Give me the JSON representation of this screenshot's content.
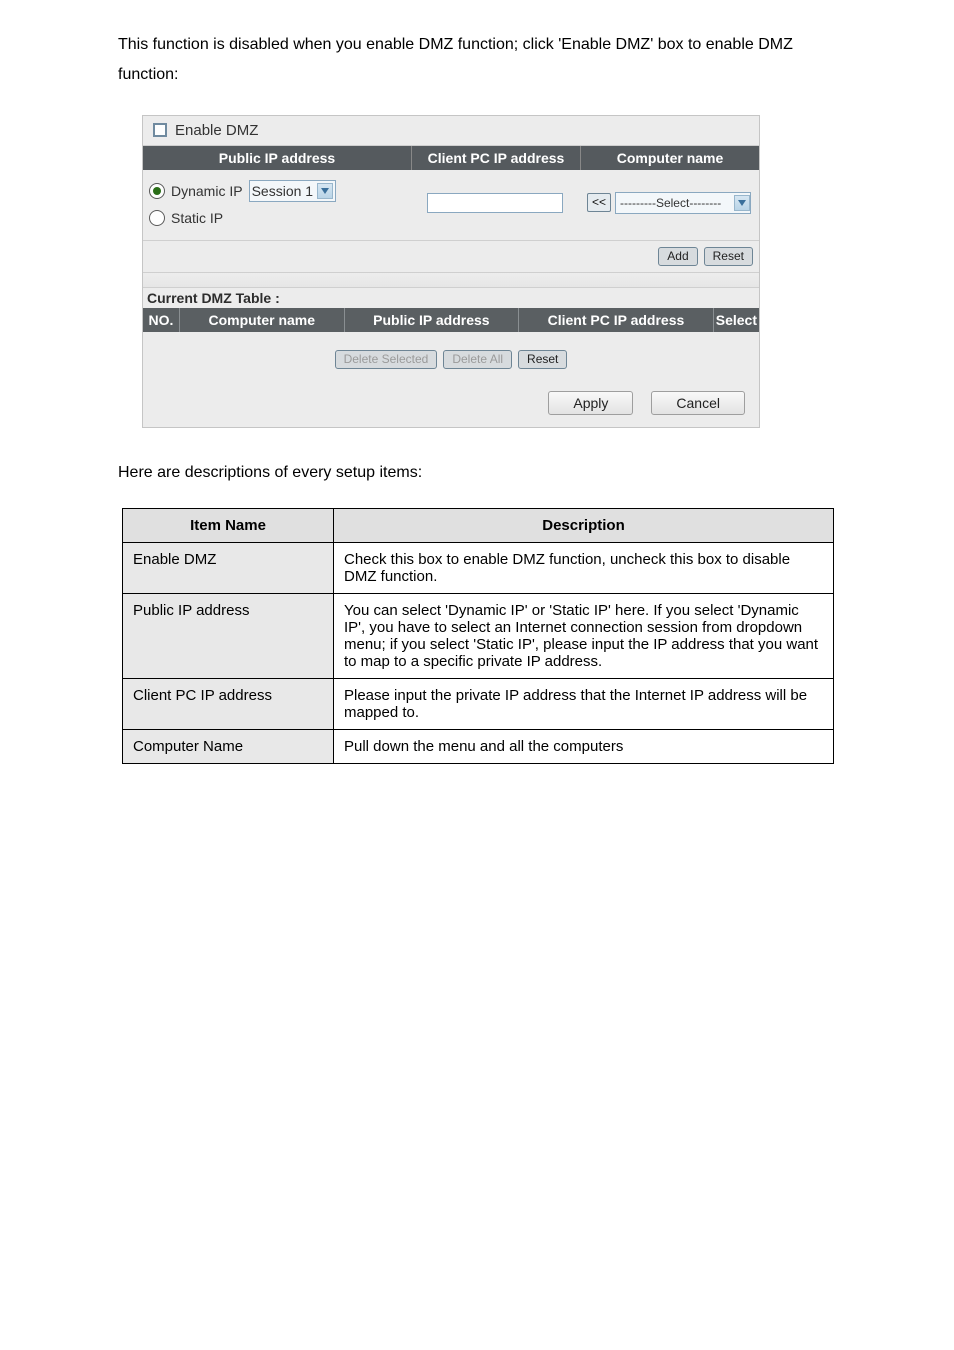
{
  "intro": "This function is disabled when you enable DMZ function; click 'Enable DMZ' box to enable DMZ function:",
  "panel": {
    "enable_label": "Enable DMZ",
    "head": {
      "public_ip": "Public IP address",
      "client_ip": "Client PC IP address",
      "computer": "Computer name"
    },
    "radios": {
      "dynamic": "Dynamic IP",
      "static": "Static IP"
    },
    "session_select": "Session 1",
    "assign_button": "<<",
    "select_placeholder": "---------Select--------",
    "add_button": "Add",
    "reset_button": "Reset",
    "table_title": "Current DMZ Table :",
    "head2": {
      "no": "NO.",
      "computer": "Computer name",
      "public_ip": "Public IP address",
      "client_ip": "Client PC IP address",
      "select": "Select"
    },
    "buttons": {
      "delete_selected": "Delete Selected",
      "delete_all": "Delete All",
      "reset2": "Reset",
      "apply": "Apply",
      "cancel": "Cancel"
    }
  },
  "outtro": "Here are descriptions of every setup items:",
  "table": {
    "header_item": "Item Name",
    "header_desc": "Description",
    "rows": [
      {
        "item": "Enable DMZ",
        "desc": "Check this box to enable DMZ function, uncheck this box to disable DMZ function."
      },
      {
        "item": "Public IP address",
        "desc": "You can select 'Dynamic IP' or 'Static IP' here. If you select 'Dynamic IP', you have to select an Internet connection session from dropdown menu; if you select 'Static IP', please input the IP address that you want to map to a specific private IP address."
      },
      {
        "item": "Client PC IP address",
        "desc": "Please input the private IP address that the Internet IP address will be mapped to."
      },
      {
        "item": "Computer Name",
        "desc": "Pull down the menu and all the computers"
      }
    ]
  }
}
